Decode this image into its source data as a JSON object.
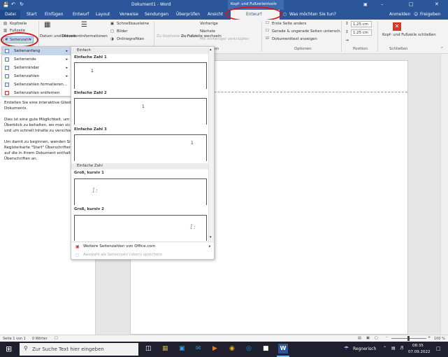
{
  "title": {
    "doc": "Dokument1 - Word",
    "context": "Kopf- und Fußzeilentools",
    "signin": "Anmelden"
  },
  "tabs": {
    "file": "Datei",
    "start": "Start",
    "insert": "Einfügen",
    "design": "Entwurf",
    "layout": "Layout",
    "refs": "Verweise",
    "mail": "Sendungen",
    "review": "Überprüfen",
    "view": "Ansicht",
    "context": "Entwurf",
    "tell": "Was möchten Sie tun?",
    "share": "Freigeben"
  },
  "ribbon": {
    "header": "Kopfzeile",
    "footer": "Fußzeile",
    "pagenum": "Seitenzahl",
    "datetime": "Datum und Uhrzeit",
    "docinfo": "Dokumentinformationen",
    "quickparts": "Schnellbausteine",
    "pictures": "Bilder",
    "online": "Onlinegrafiken",
    "goheader": "Zu Kopfzeile wechseln",
    "gofooter": "Zu Fußzeile wechseln",
    "prev": "Vorherige",
    "next": "Nächste",
    "link": "Mit vorheriger verknüpfen",
    "firstpage": "Erste Seite anders",
    "oddeven": "Gerade & ungerade Seiten untersch.",
    "showtext": "Dokumenttext anzeigen",
    "top_val": "1,25 cm",
    "bottom_val": "1,25 cm",
    "close": "Kopf- und Fußzeile schließen",
    "grp_nav": "ion",
    "grp_options": "Optionen",
    "grp_position": "Position",
    "grp_close": "Schließen"
  },
  "menu": {
    "items": [
      {
        "label": "Seitenanfang"
      },
      {
        "label": "Seitenende"
      },
      {
        "label": "Seitenränder"
      },
      {
        "label": "Seitenzahlen"
      },
      {
        "label": "Seitenzahlen formatieren..."
      },
      {
        "label": "Seitenzahlen entfernen"
      }
    ]
  },
  "gallery": {
    "head1": "Einfach",
    "i1": "Einfache Zahl 1",
    "i2": "Einfache Zahl 2",
    "i3": "Einfache Zahl 3",
    "head2": "Einfache Zahl",
    "i4": "Groß, kursiv 1",
    "i5": "Groß, kursiv 2",
    "num": "1",
    "bignum": "1:",
    "more": "Weitere Seitenzahlen von Office.com",
    "save": "Auswahl als Seitenzahl (oben) speichern"
  },
  "navpane": {
    "p1": "Erstellen Sie eine interaktive Gliederung Ihres Dokuments.",
    "p2": "Dies ist eine gute Möglichkeit, um den Überblick zu behalten, wo man sich befindet, und um schnell Inhalte zu verschieben.",
    "p3": "Um damit zu beginnen, wenden Sie auf der Registerkarte \"Start\" Überschriftenformate auf die in Ihrem Dokument enthaltenen Überschriften an."
  },
  "status": {
    "page": "Seite 1 von 1",
    "words": "0 Wörter",
    "zoom": "100 %"
  },
  "taskbar": {
    "search": "Zur Suche Text hier eingeben",
    "weather": "Regnerisch",
    "time": "08:35",
    "date": "07.09.2022"
  },
  "colors": {
    "accent": "#2b579a",
    "highlight": "#d4161c"
  }
}
